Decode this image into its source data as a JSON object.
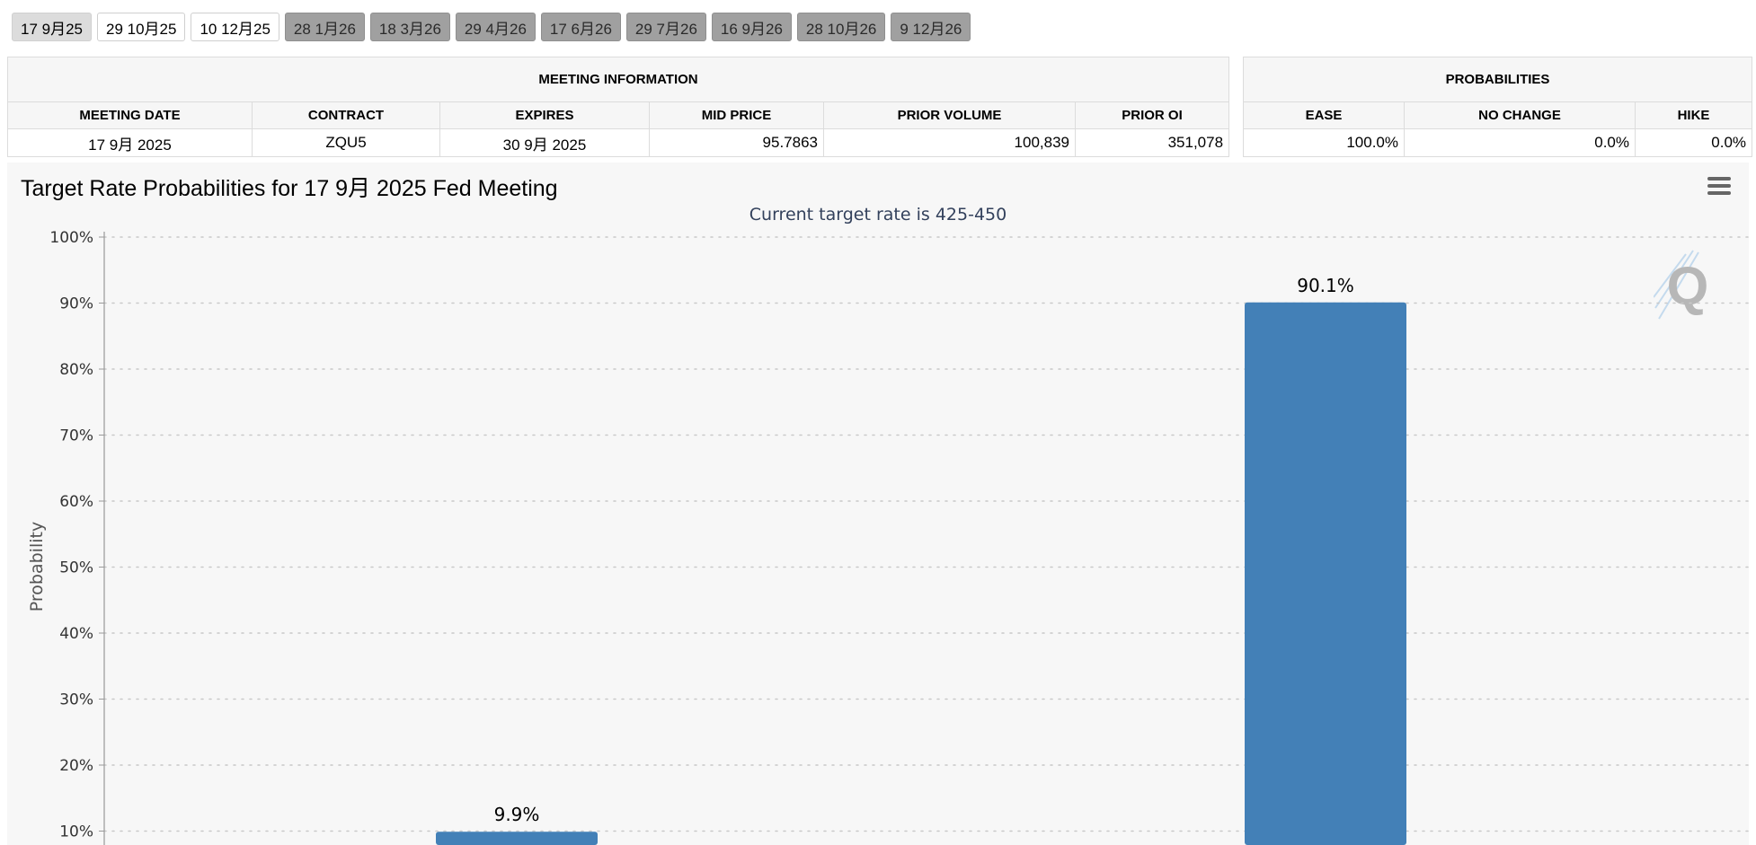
{
  "tabs": [
    {
      "label": "17 9月25",
      "style": "active"
    },
    {
      "label": "29 10月25",
      "style": "light"
    },
    {
      "label": "10 12月25",
      "style": "light"
    },
    {
      "label": "28 1月26",
      "style": "dark"
    },
    {
      "label": "18 3月26",
      "style": "dark"
    },
    {
      "label": "29 4月26",
      "style": "dark"
    },
    {
      "label": "17 6月26",
      "style": "dark"
    },
    {
      "label": "29 7月26",
      "style": "dark"
    },
    {
      "label": "16 9月26",
      "style": "dark"
    },
    {
      "label": "28 10月26",
      "style": "dark"
    },
    {
      "label": "9 12月26",
      "style": "dark"
    }
  ],
  "meeting_info": {
    "title": "MEETING INFORMATION",
    "headers": [
      "MEETING DATE",
      "CONTRACT",
      "EXPIRES",
      "MID PRICE",
      "PRIOR VOLUME",
      "PRIOR OI"
    ],
    "row": [
      "17 9月 2025",
      "ZQU5",
      "30 9月 2025",
      "95.7863",
      "100,839",
      "351,078"
    ]
  },
  "probabilities": {
    "title": "PROBABILITIES",
    "headers": [
      "EASE",
      "NO CHANGE",
      "HIKE"
    ],
    "row": [
      "100.0%",
      "0.0%",
      "0.0%"
    ]
  },
  "chart": {
    "title": "Target Rate Probabilities for 17 9月 2025 Fed Meeting",
    "subtitle": "Current target rate is 425-450",
    "menu_icon": "hamburger-menu-icon",
    "watermark_icon": "q-logo-icon",
    "colors": {
      "bar": "#4380b7",
      "grid": "#c9c9c9",
      "axis": "#9a9a9a",
      "text": "#333333"
    }
  },
  "chart_data": {
    "type": "bar",
    "ylabel": "Probability",
    "ylim": [
      0,
      100
    ],
    "yticks": [
      "100%",
      "90%",
      "80%",
      "70%",
      "60%",
      "50%",
      "40%",
      "30%",
      "20%",
      "10%"
    ],
    "values": [
      9.9,
      90.1
    ],
    "data_labels": [
      "9.9%",
      "90.1%"
    ],
    "grid": true,
    "note": "x-axis category labels are below the visible area"
  }
}
